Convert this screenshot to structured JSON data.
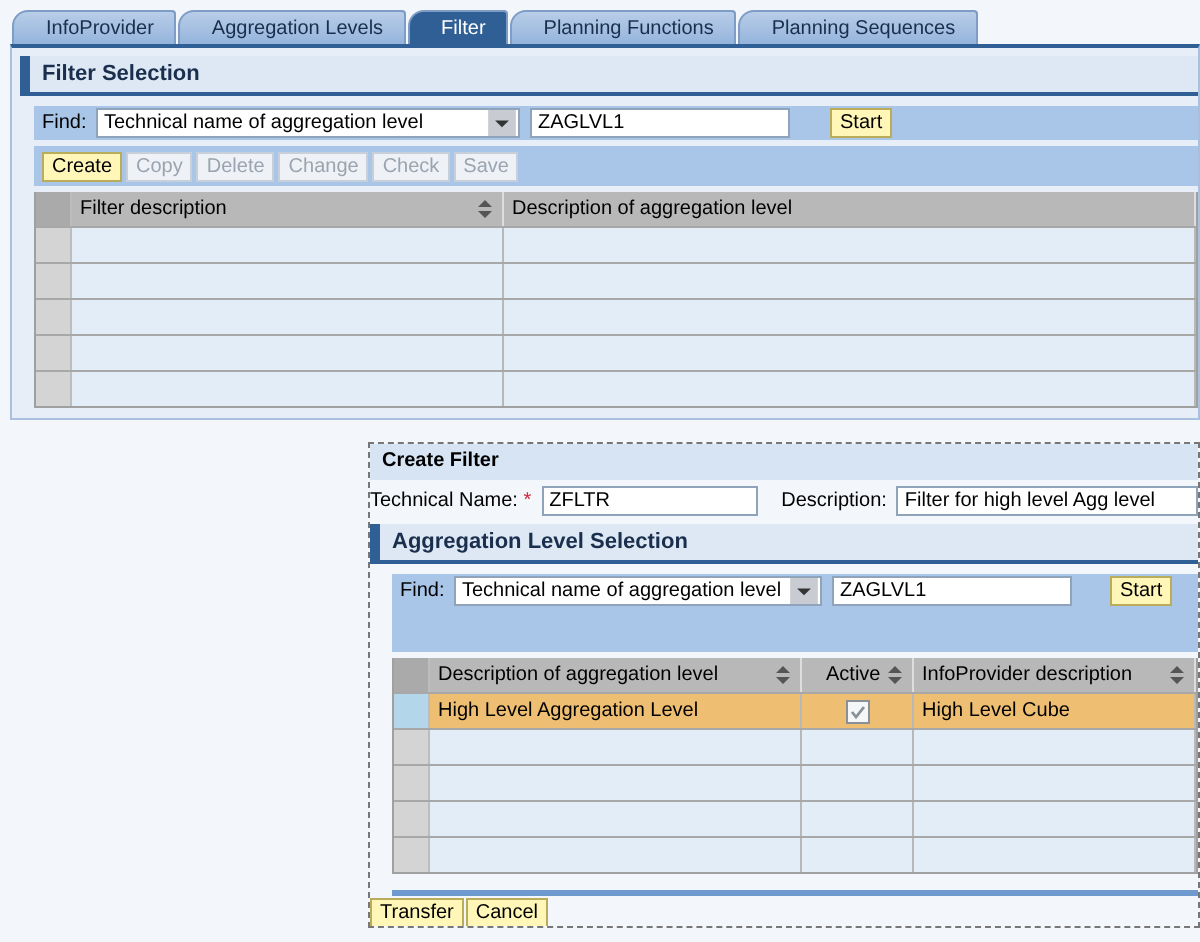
{
  "tabs": [
    {
      "label": "InfoProvider",
      "selected": false
    },
    {
      "label": "Aggregation Levels",
      "selected": false
    },
    {
      "label": "Filter",
      "selected": true
    },
    {
      "label": "Planning Functions",
      "selected": false
    },
    {
      "label": "Planning Sequences",
      "selected": false
    }
  ],
  "filter_selection": {
    "title": "Filter Selection",
    "find_label": "Find:",
    "find_by": "Technical name of aggregation level",
    "find_value": "ZAGLVL1",
    "start_button": "Start",
    "toolbar": [
      {
        "label": "Create",
        "disabled": false
      },
      {
        "label": "Copy",
        "disabled": true
      },
      {
        "label": "Delete",
        "disabled": true
      },
      {
        "label": "Change",
        "disabled": true
      },
      {
        "label": "Check",
        "disabled": true
      },
      {
        "label": "Save",
        "disabled": true
      }
    ],
    "table": {
      "columns": [
        {
          "label": "Filter description",
          "sortable": true
        },
        {
          "label": "Description of aggregation level",
          "sortable": false
        }
      ],
      "rows": [
        {
          "selected": false
        },
        {
          "selected": false
        },
        {
          "selected": false
        },
        {
          "selected": false
        },
        {
          "selected": false
        }
      ]
    }
  },
  "create_filter": {
    "title": "Create Filter",
    "technical_name_label": "Technical Name:",
    "required_mark": "*",
    "technical_name": "ZFLTR",
    "description_label": "Description:",
    "description": "Filter for high level Agg level",
    "selection": {
      "title": "Aggregation Level Selection",
      "find_label": "Find:",
      "find_by": "Technical name of aggregation level",
      "find_value": "ZAGLVL1",
      "start_button": "Start",
      "table": {
        "columns": [
          {
            "label": "Description of aggregation level",
            "sortable": true
          },
          {
            "label": "Active",
            "sortable": true
          },
          {
            "label": "InfoProvider description",
            "sortable": true
          }
        ],
        "rows": [
          {
            "selected": true,
            "description": "High Level Aggregation Level",
            "active": true,
            "infoprovider": "High Level Cube"
          },
          {
            "selected": false
          },
          {
            "selected": false
          },
          {
            "selected": false
          },
          {
            "selected": false
          }
        ]
      }
    },
    "buttons": [
      "Transfer",
      "Cancel"
    ]
  }
}
